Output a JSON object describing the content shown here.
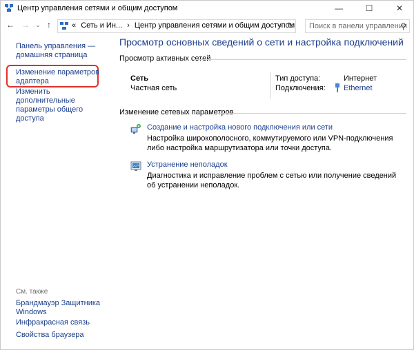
{
  "window": {
    "title": "Центр управления сетями и общим доступом",
    "controls": {
      "minimize": "—",
      "maximize": "☐",
      "close": "✕"
    }
  },
  "nav": {
    "back": "←",
    "forward": "→",
    "dropdown": "⌄",
    "up": "↑",
    "address": {
      "separator": "«",
      "crumb1": "Сеть и Ин...",
      "arrow1": "›",
      "crumb2": "Центр управления сетями и общим доступом",
      "dropdown": "⌄",
      "refresh": "↻"
    },
    "search": {
      "placeholder": "Поиск в панели управления",
      "icon": "⚲"
    }
  },
  "left": {
    "home_link": "Панель управления — домашняя страница",
    "adapter_link": "Изменение параметров адаптера",
    "sharing_link": "Изменить дополнительные параметры общего доступа",
    "see_also_title": "См. также",
    "see_also": [
      "Брандмауэр Защитника Windows",
      "Инфракрасная связь",
      "Свойства браузера"
    ]
  },
  "main": {
    "title": "Просмотр основных сведений о сети и настройка подключений",
    "active_networks_title": "Просмотр активных сетей",
    "network": {
      "name": "Сеть",
      "type": "Частная сеть",
      "access_label": "Тип доступа:",
      "access_value": "Интернет",
      "connections_label": "Подключения:",
      "connections_value": "Ethernet"
    },
    "change_settings_title": "Изменение сетевых параметров",
    "tasks": [
      {
        "icon": "network-setup-icon",
        "link": "Создание и настройка нового подключения или сети",
        "desc": "Настройка широкополосного, коммутируемого или VPN-подключения либо настройка маршрутизатора или точки доступа."
      },
      {
        "icon": "troubleshoot-icon",
        "link": "Устранение неполадок",
        "desc": "Диагностика и исправление проблем с сетью или получение сведений об устранении неполадок."
      }
    ]
  },
  "colors": {
    "link": "#1a3e8c",
    "highlight": "#e0302a"
  }
}
